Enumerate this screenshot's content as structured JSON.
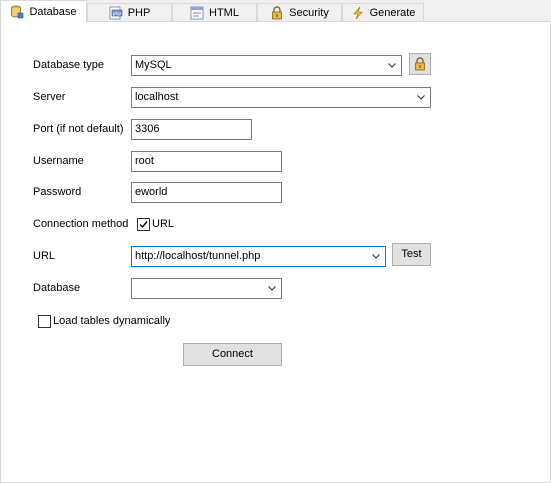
{
  "tabs": [
    {
      "label": "Database",
      "icon": "database-icon"
    },
    {
      "label": "PHP",
      "icon": "php-icon"
    },
    {
      "label": "HTML",
      "icon": "html-icon"
    },
    {
      "label": "Security",
      "icon": "lock-icon"
    },
    {
      "label": "Generate",
      "icon": "lightning-icon"
    }
  ],
  "form": {
    "database_type": {
      "label": "Database type",
      "value": "MySQL"
    },
    "server": {
      "label": "Server",
      "value": "localhost"
    },
    "port": {
      "label": "Port (if not default)",
      "value": "3306"
    },
    "username": {
      "label": "Username",
      "value": "root"
    },
    "password": {
      "label": "Password",
      "value": "eworld"
    },
    "connection_method": {
      "label": "Connection method",
      "checkbox_label": "URL",
      "checked": true
    },
    "url": {
      "label": "URL",
      "value": "http://localhost/tunnel.php",
      "test_button": "Test"
    },
    "database": {
      "label": "Database",
      "value": ""
    },
    "load_tables": {
      "label": "Load tables dynamically",
      "checked": false
    },
    "connect_button": "Connect"
  },
  "colors": {
    "focus": "#0078d7",
    "panel": "#ffffff",
    "window": "#f0f0f0"
  }
}
